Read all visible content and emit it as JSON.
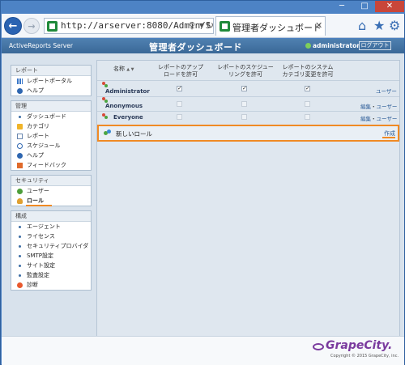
{
  "browser": {
    "address_url": "http://arserver:8080/Admin/S",
    "tab_title": "管理者ダッシュボード",
    "min_glyph": "─",
    "max_glyph": "□",
    "close_glyph": "✕",
    "back_glyph": "←",
    "forward_glyph": "→",
    "search_glyph": "⚲",
    "dropdown_glyph": "▼",
    "refresh_glyph": "↻",
    "tab_close_glyph": "✕",
    "home_glyph": "⌂",
    "star_glyph": "★",
    "gear_glyph": "⚙"
  },
  "header": {
    "brand": "ActiveReports Server",
    "title": "管理者ダッシュボード",
    "user": "administrator",
    "logout": "ログアウト"
  },
  "sidebar": {
    "report": {
      "title": "レポート",
      "items": [
        {
          "label": "レポートポータル",
          "icon": "chart-icon"
        },
        {
          "label": "ヘルプ",
          "icon": "help-icon"
        }
      ]
    },
    "manage": {
      "title": "管理",
      "items": [
        {
          "label": "ダッシュボード",
          "icon": "bullet-icon"
        },
        {
          "label": "カテゴリ",
          "icon": "folder-icon"
        },
        {
          "label": "レポート",
          "icon": "document-icon"
        },
        {
          "label": "スケジュール",
          "icon": "clock-icon"
        },
        {
          "label": "ヘルプ",
          "icon": "help-icon"
        },
        {
          "label": "フィードバック",
          "icon": "flag-icon"
        }
      ]
    },
    "security": {
      "title": "セキュリティ",
      "items": [
        {
          "label": "ユーザー",
          "icon": "user-icon"
        },
        {
          "label": "ロール",
          "icon": "role-icon"
        }
      ]
    },
    "config": {
      "title": "構成",
      "items": [
        {
          "label": "エージェント",
          "icon": "bullet-icon"
        },
        {
          "label": "ライセンス",
          "icon": "bullet-icon"
        },
        {
          "label": "セキュリティプロバイダ",
          "icon": "bullet-icon"
        },
        {
          "label": "SMTP設定",
          "icon": "bullet-icon"
        },
        {
          "label": "サイト設定",
          "icon": "bullet-icon"
        },
        {
          "label": "監査設定",
          "icon": "bullet-icon"
        },
        {
          "label": "診断",
          "icon": "diagnostics-icon"
        }
      ]
    }
  },
  "roles_table": {
    "col_name": "名称",
    "sort_glyph": "▲ ▼",
    "col_upload_1": "レポートのアップ",
    "col_upload_2": "ロードを許可",
    "col_schedule_1": "レポートのスケジュー",
    "col_schedule_2": "リングを許可",
    "col_category_1": "レポートのシステム",
    "col_category_2": "カテゴリ変更を許可",
    "check_glyph": "✓",
    "rows": [
      {
        "name": "Administrator",
        "upload": true,
        "schedule": true,
        "category": true,
        "edit": "",
        "sep": "",
        "users": "ユーザー"
      },
      {
        "name": "Anonymous",
        "upload": false,
        "schedule": false,
        "category": false,
        "edit": "編集",
        "sep": "・",
        "users": "ユーザー"
      },
      {
        "name": "Everyone",
        "upload": false,
        "schedule": false,
        "category": false,
        "edit": "編集",
        "sep": "・",
        "users": "ユーザー"
      }
    ],
    "new_role_label": "新しいロール",
    "create_link": "作成"
  },
  "footer": {
    "logo": "GrapeCity.",
    "copyright": "Copyright © 2015 GrapeCity, inc."
  },
  "colors": {
    "header_bg": "#3f6f9f",
    "highlight": "#f08a24",
    "logo": "#7a3a9e"
  }
}
